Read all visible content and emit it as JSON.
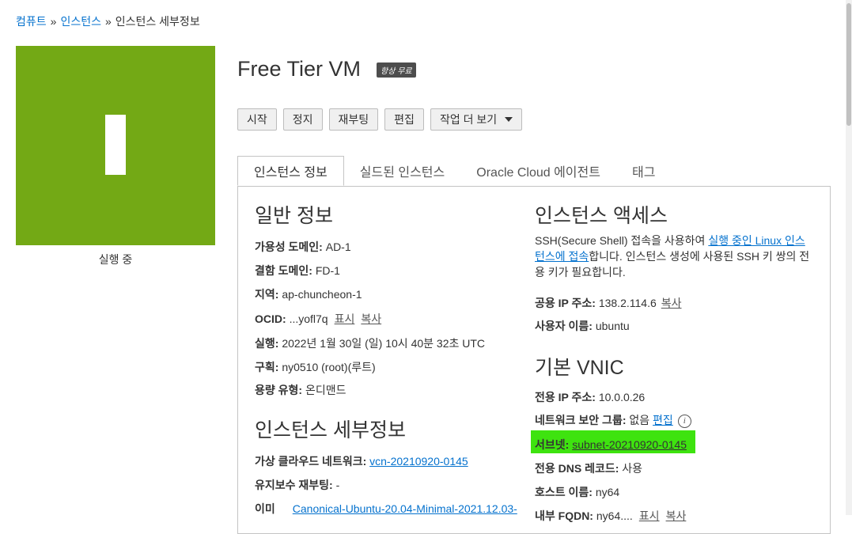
{
  "breadcrumb": {
    "item1": "컴퓨트",
    "item2": "인스턴스",
    "separator": "»",
    "current": "인스턴스 세부정보"
  },
  "tile": {
    "status": "실행 중",
    "color": "#73a915"
  },
  "header": {
    "title": "Free Tier VM",
    "badge": "항상 무료"
  },
  "actions": {
    "start": "시작",
    "stop": "정지",
    "reboot": "재부팅",
    "edit": "편집",
    "more": "작업 더 보기"
  },
  "tabs": [
    "인스턴스 정보",
    "실드된 인스턴스",
    "Oracle Cloud 에이전트",
    "태그"
  ],
  "general": {
    "heading": "일반 정보",
    "ad_label": "가용성 도메인:",
    "ad_value": "AD-1",
    "fd_label": "결함 도메인:",
    "fd_value": "FD-1",
    "region_label": "지역:",
    "region_value": "ap-chuncheon-1",
    "ocid_label": "OCID:",
    "ocid_value": "...yofl7q",
    "show": "표시",
    "copy": "복사",
    "launched_label": "실행:",
    "launched_value": "2022년 1월 30일 (일) 10시 40분 32초 UTC",
    "compartment_label": "구획:",
    "compartment_value": "ny0510 (root)(루트)",
    "capacity_label": "용량 유형:",
    "capacity_value": "온디맨드"
  },
  "details": {
    "heading": "인스턴스 세부정보",
    "vcn_label": "가상 클라우드 네트워크:",
    "vcn_value": "vcn-20210920-0145",
    "maint_label": "유지보수 재부팅:",
    "maint_value": "-",
    "image_label": "이미",
    "image_value": "Canonical-Ubuntu-20.04-Minimal-2021.12.03-"
  },
  "access": {
    "heading": "인스턴스 액세스",
    "text1": "SSH(Secure Shell) 접속을 사용하여 ",
    "link": "실행 중인 Linux 인스턴스에 접속",
    "text2": "합니다. 인스턴스 생성에 사용된 SSH 키 쌍의 전용 키가 필요합니다.",
    "ip_label": "공용 IP 주소:",
    "ip_value": "138.2.114.6",
    "copy": "복사",
    "user_label": "사용자 이름:",
    "user_value": "ubuntu"
  },
  "vnic": {
    "heading": "기본 VNIC",
    "private_ip_label": "전용 IP 주소:",
    "private_ip_value": "10.0.0.26",
    "nsg_label": "네트워크 보안 그룹:",
    "nsg_value": "없음",
    "edit": "편집",
    "subnet_label": "서브넷:",
    "subnet_value": "subnet-20210920-0145",
    "dns_label": "전용 DNS 레코드:",
    "dns_value": "사용",
    "host_label": "호스트 이름:",
    "host_value": "ny64",
    "fqdn_label": "내부 FQDN:",
    "fqdn_value": "ny64....",
    "show": "표시",
    "copy": "복사",
    "highlight_color": "#3ee30f"
  }
}
